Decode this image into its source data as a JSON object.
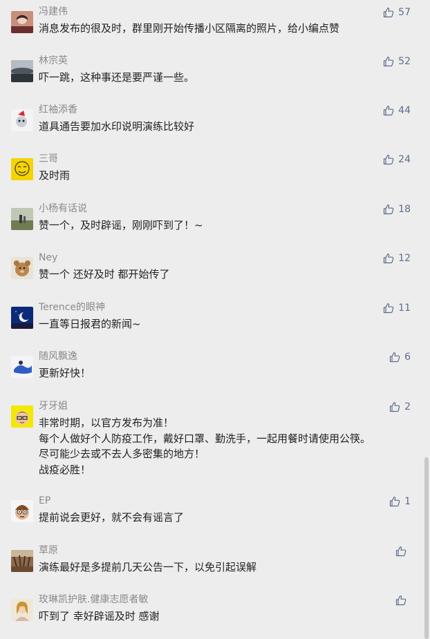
{
  "comments": [
    {
      "name": "冯建伟",
      "lines": [
        "消息发布的很及时，群里刚开始传播小区隔离的照片，给小编点赞"
      ],
      "likes": "57"
    },
    {
      "name": "林宗英",
      "lines": [
        "吓一跳，这种事还是要严谨一些。"
      ],
      "likes": "52"
    },
    {
      "name": "红袖添香",
      "lines": [
        "道具通告要加水印说明演练比较好"
      ],
      "likes": "44"
    },
    {
      "name": "三哥",
      "lines": [
        "及时雨"
      ],
      "likes": "24"
    },
    {
      "name": "小杨有话说",
      "lines": [
        "赞一个，及时辟谣，刚刚吓到了！~"
      ],
      "likes": "18"
    },
    {
      "name": "Ney",
      "lines": [
        "赞一个 还好及时 都开始传了"
      ],
      "likes": "12"
    },
    {
      "name": "Terence的眼神",
      "lines": [
        "一直等日报君的新闻~"
      ],
      "likes": "11"
    },
    {
      "name": "随风飘逸",
      "lines": [
        "更新好快！"
      ],
      "likes": "6"
    },
    {
      "name": "牙牙姐",
      "lines": [
        "非常时期，以官方发布为准！",
        "每个人做好个人防疫工作，戴好口罩、勤洗手，一起用餐时请使用公筷。",
        "尽可能少去或不去人多密集的地方！",
        "战疫必胜！"
      ],
      "likes": "2"
    },
    {
      "name": "EP",
      "lines": [
        "提前说会更好，就不会有谣言了"
      ],
      "likes": "1"
    },
    {
      "name": "草原",
      "lines": [
        "演练最好是多提前几天公告一下，以免引起误解"
      ],
      "likes": ""
    },
    {
      "name": "玫琳凯护肤.健康志愿者敏",
      "lines": [
        "吓到了  幸好辟谣及时  感谢"
      ],
      "likes": ""
    }
  ],
  "icons": {
    "like": "thumbs-up-icon",
    "avatar": "user-avatar"
  },
  "colors": {
    "name": "#8a8a8a",
    "text": "#222222",
    "like": "#5e6c8a",
    "background": "#ededed"
  }
}
